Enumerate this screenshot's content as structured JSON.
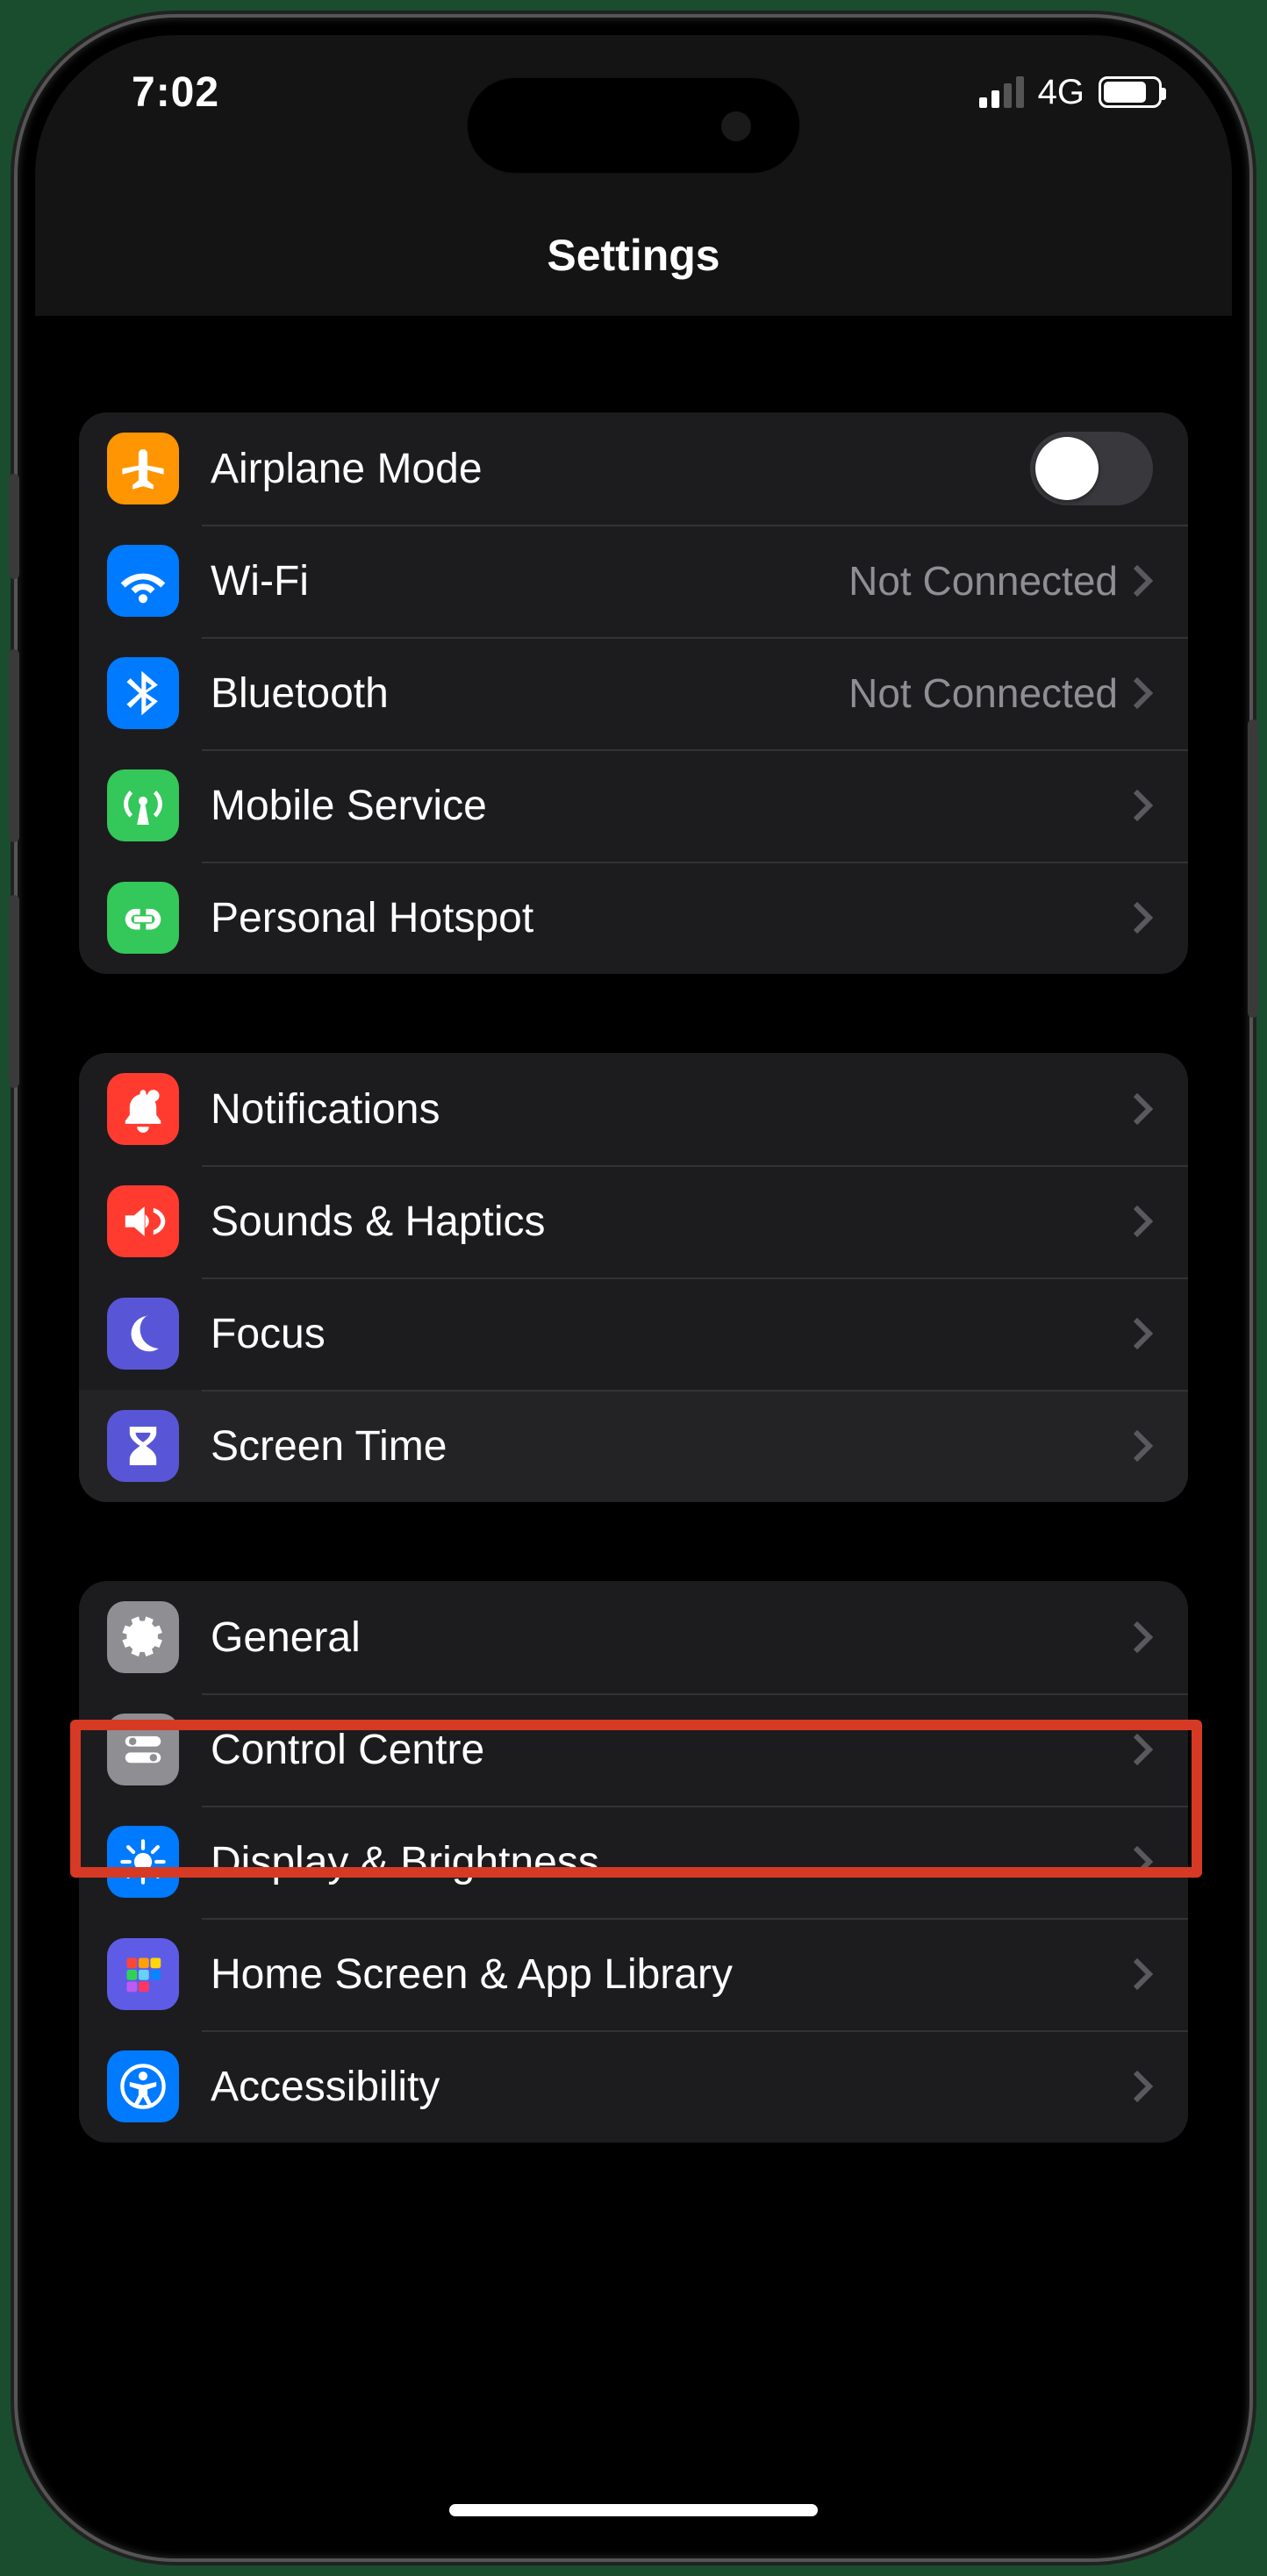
{
  "status": {
    "time": "7:02",
    "network": "4G"
  },
  "header": {
    "title": "Settings"
  },
  "groups": [
    {
      "rows": [
        {
          "id": "airplane-mode",
          "label": "Airplane Mode",
          "type": "toggle",
          "toggle_on": false,
          "icon": "airplane",
          "icon_bg": "bg-orange"
        },
        {
          "id": "wifi",
          "label": "Wi-Fi",
          "type": "link",
          "detail": "Not Connected",
          "icon": "wifi",
          "icon_bg": "bg-blue"
        },
        {
          "id": "bluetooth",
          "label": "Bluetooth",
          "type": "link",
          "detail": "Not Connected",
          "icon": "bluetooth",
          "icon_bg": "bg-blue"
        },
        {
          "id": "mobile-service",
          "label": "Mobile Service",
          "type": "link",
          "icon": "antenna",
          "icon_bg": "bg-green"
        },
        {
          "id": "personal-hotspot",
          "label": "Personal Hotspot",
          "type": "link",
          "icon": "hotspot",
          "icon_bg": "bg-green"
        }
      ]
    },
    {
      "rows": [
        {
          "id": "notifications",
          "label": "Notifications",
          "type": "link",
          "icon": "bell",
          "icon_bg": "bg-red"
        },
        {
          "id": "sounds-haptics",
          "label": "Sounds & Haptics",
          "type": "link",
          "icon": "speaker",
          "icon_bg": "bg-red"
        },
        {
          "id": "focus",
          "label": "Focus",
          "type": "link",
          "icon": "moon",
          "icon_bg": "bg-indigo"
        },
        {
          "id": "screen-time",
          "label": "Screen Time",
          "type": "link",
          "icon": "hourglass",
          "icon_bg": "bg-indigo",
          "highlighted": true
        }
      ]
    },
    {
      "rows": [
        {
          "id": "general",
          "label": "General",
          "type": "link",
          "icon": "gear",
          "icon_bg": "bg-gray"
        },
        {
          "id": "control-centre",
          "label": "Control Centre",
          "type": "link",
          "icon": "switches",
          "icon_bg": "bg-gray"
        },
        {
          "id": "display-brightness",
          "label": "Display & Brightness",
          "type": "link",
          "icon": "sun",
          "icon_bg": "bg-blue"
        },
        {
          "id": "home-screen",
          "label": "Home Screen & App Library",
          "type": "link",
          "icon": "grid",
          "icon_bg": "bg-purple"
        },
        {
          "id": "accessibility",
          "label": "Accessibility",
          "type": "link",
          "icon": "person",
          "icon_bg": "bg-blue"
        }
      ]
    }
  ]
}
